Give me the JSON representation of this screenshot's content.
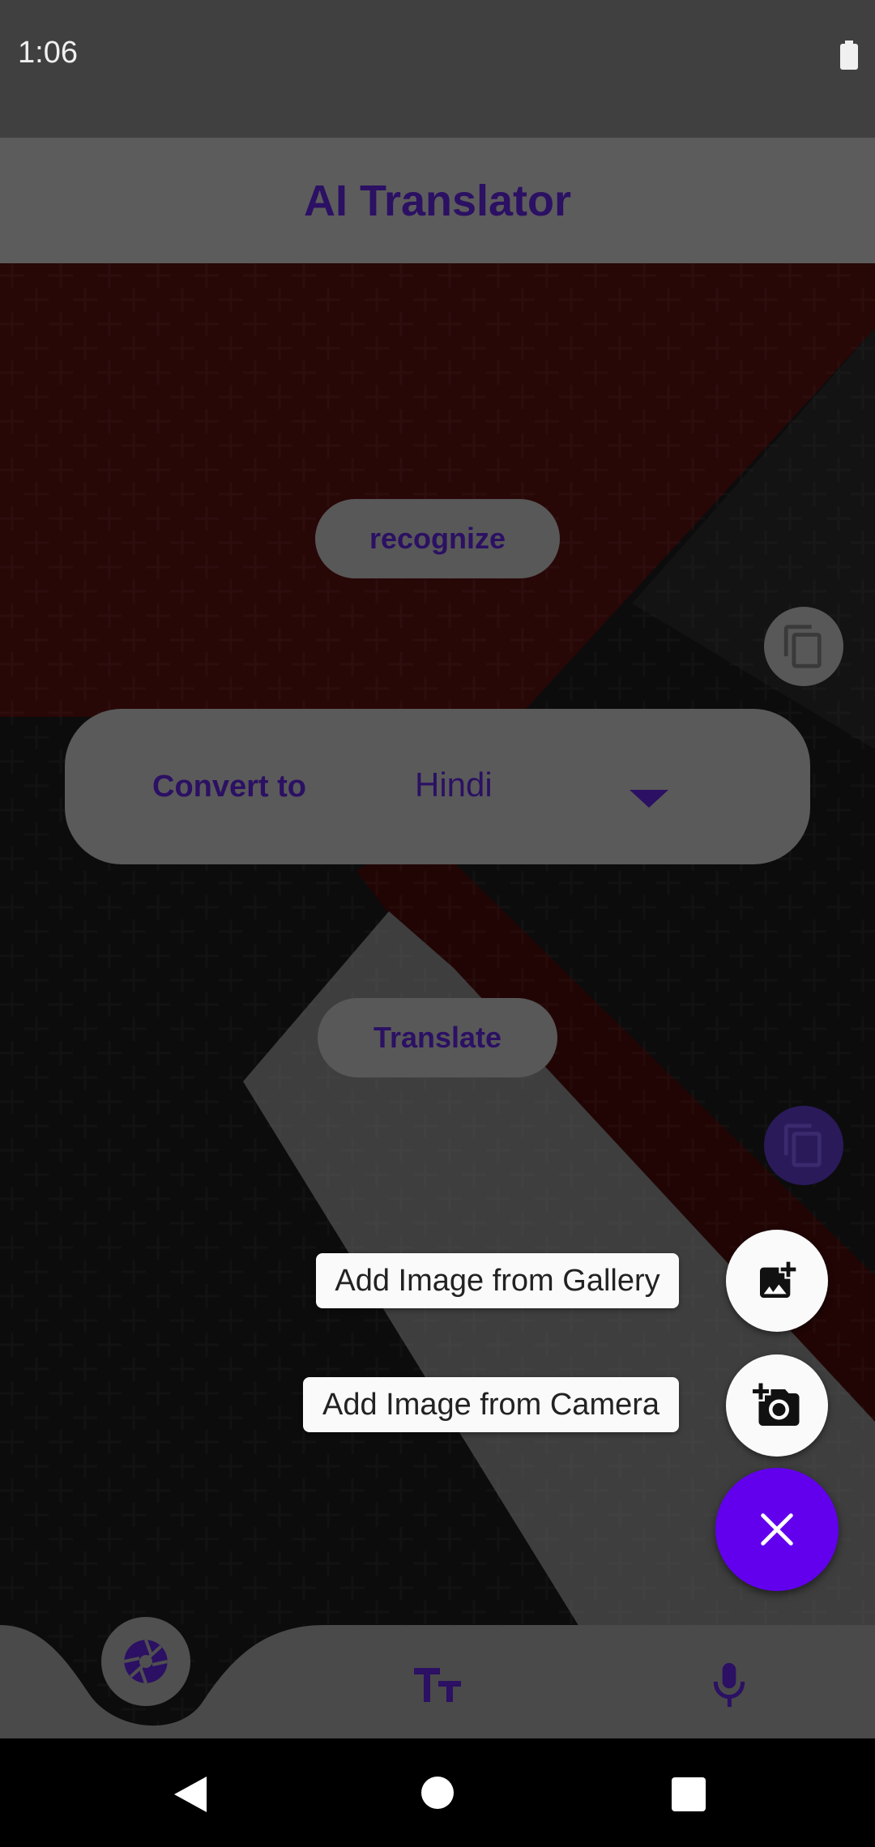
{
  "status_bar": {
    "time": "1:06",
    "battery_icon": "battery-full-icon"
  },
  "app_bar": {
    "title": "AI Translator"
  },
  "content": {
    "recognize_label": "recognize",
    "translate_label": "Translate",
    "convert_to_label": "Convert to",
    "selected_language": "Hindi",
    "copy_icon": "copy-icon"
  },
  "speed_dial": {
    "gallery_label": "Add Image from Gallery",
    "camera_label": "Add Image from Camera",
    "gallery_icon": "add-photo-icon",
    "camera_icon": "add-camera-icon",
    "close_icon": "close-icon"
  },
  "bottom_nav": {
    "items": [
      "camera-lens-icon",
      "text-size-icon",
      "microphone-icon"
    ]
  },
  "colors": {
    "accent": "#6200ee",
    "title_text": "#2b1063",
    "app_bar": "#5c5c5c",
    "status_bar": "#404040"
  }
}
